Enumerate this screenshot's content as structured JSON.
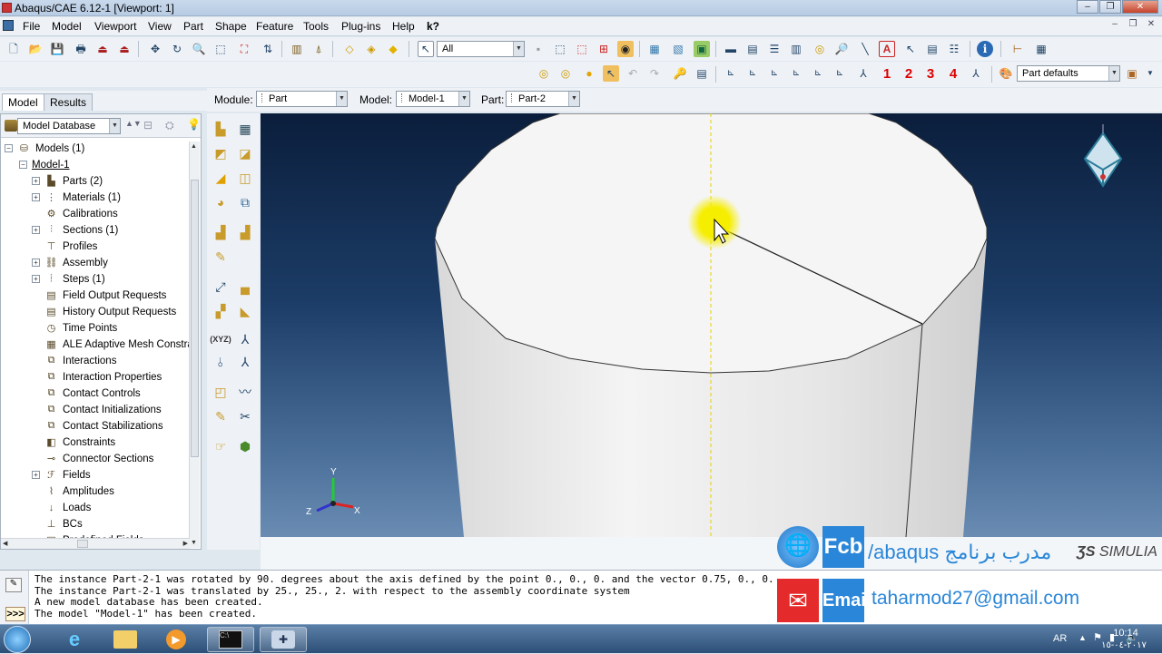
{
  "window": {
    "title": "Abaqus/CAE 6.12-1 [Viewport: 1]"
  },
  "menu": [
    "File",
    "Model",
    "Viewport",
    "View",
    "Part",
    "Shape",
    "Feature",
    "Tools",
    "Plug-ins",
    "Help",
    "k?"
  ],
  "toolbar": {
    "selection_filter": "All",
    "render_style": "Part defaults",
    "views": [
      "1",
      "2",
      "3",
      "4"
    ]
  },
  "tabs": {
    "model": "Model",
    "results": "Results"
  },
  "context": {
    "module_label": "Module:",
    "module_value": "Part",
    "model_label": "Model:",
    "model_value": "Model-1",
    "part_label": "Part:",
    "part_value": "Part-2"
  },
  "tree": {
    "header": "Model Database",
    "root": "Models (1)",
    "model": "Model-1",
    "items": [
      {
        "label": "Parts (2)",
        "exp": true,
        "icon": "parts-icon"
      },
      {
        "label": "Materials (1)",
        "exp": true,
        "icon": "materials-icon"
      },
      {
        "label": "Calibrations",
        "exp": false,
        "icon": "calibrations-icon"
      },
      {
        "label": "Sections (1)",
        "exp": true,
        "icon": "sections-icon"
      },
      {
        "label": "Profiles",
        "exp": false,
        "icon": "profiles-icon"
      },
      {
        "label": "Assembly",
        "exp": true,
        "icon": "assembly-icon"
      },
      {
        "label": "Steps (1)",
        "exp": true,
        "icon": "steps-icon"
      },
      {
        "label": "Field Output Requests",
        "exp": false,
        "icon": "field-output-icon"
      },
      {
        "label": "History Output Requests",
        "exp": false,
        "icon": "history-output-icon"
      },
      {
        "label": "Time Points",
        "exp": false,
        "icon": "time-points-icon"
      },
      {
        "label": "ALE Adaptive Mesh Constra",
        "exp": false,
        "icon": "ale-mesh-icon"
      },
      {
        "label": "Interactions",
        "exp": false,
        "icon": "interactions-icon"
      },
      {
        "label": "Interaction Properties",
        "exp": false,
        "icon": "interaction-properties-icon"
      },
      {
        "label": "Contact Controls",
        "exp": false,
        "icon": "contact-controls-icon"
      },
      {
        "label": "Contact Initializations",
        "exp": false,
        "icon": "contact-init-icon"
      },
      {
        "label": "Contact Stabilizations",
        "exp": false,
        "icon": "contact-stab-icon"
      },
      {
        "label": "Constraints",
        "exp": false,
        "icon": "constraints-icon"
      },
      {
        "label": "Connector Sections",
        "exp": false,
        "icon": "connector-icon"
      },
      {
        "label": "Fields",
        "exp": true,
        "icon": "fields-icon"
      },
      {
        "label": "Amplitudes",
        "exp": false,
        "icon": "amplitudes-icon"
      },
      {
        "label": "Loads",
        "exp": false,
        "icon": "loads-icon"
      },
      {
        "label": "BCs",
        "exp": false,
        "icon": "bcs-icon"
      },
      {
        "label": "Predefined Fields",
        "exp": false,
        "icon": "predefined-fields-icon"
      }
    ]
  },
  "messages": [
    "The instance Part-2-1 was rotated by 90. degrees about the axis defined by the point 0., 0., 0. and the vector 0.75, 0., 0.",
    "The instance Part-2-1 was translated by 25., 25., 2. with respect to the assembly coordinate system",
    "A new model database has been created.",
    "The model \"Model-1\" has been created."
  ],
  "brand": {
    "fb_label": "Fcb",
    "fb_text": "/abaqus مدرب برنامج",
    "email_label": "Email",
    "email_value": "taharmod27@gmail.com",
    "simulia": "SIMULIA"
  },
  "triad": {
    "x": "X",
    "y": "Y",
    "z": "Z"
  },
  "tray": {
    "lang": "AR",
    "time": "10:14",
    "date": "٢٠١٧-٠٤-١٥"
  },
  "colors": {
    "highlight": "#f6ee00",
    "sky_top": "#0b1e3c",
    "sky_bottom": "#6a8cb3"
  }
}
